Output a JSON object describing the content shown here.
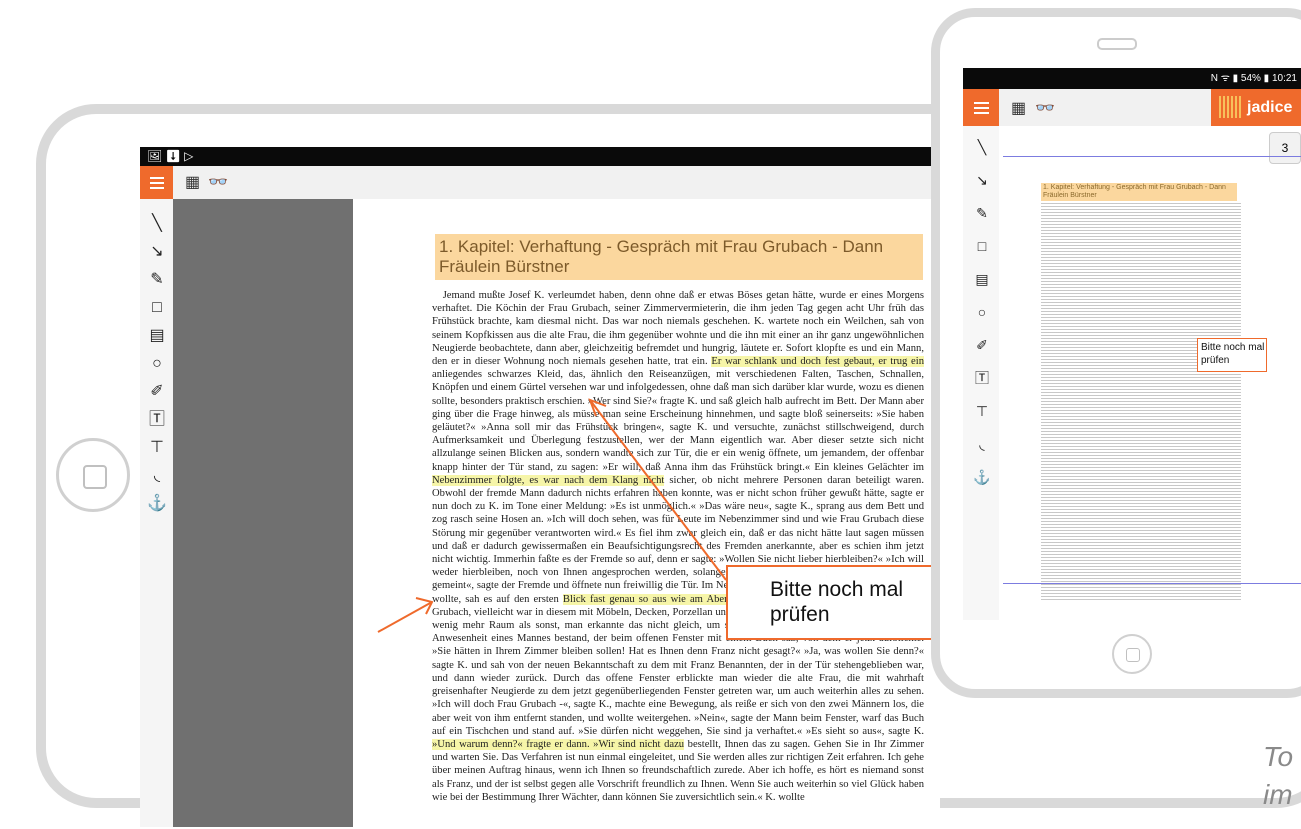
{
  "tablet": {
    "statusbar": {
      "icons": "🖼 ⬇ ▷"
    },
    "toolbar": {
      "grid_icon": "▦",
      "binoculars_icon": "👓"
    },
    "tools": [
      "line-tool-icon",
      "arrow-tool-icon",
      "freehand-tool-icon",
      "rectangle-tool-icon",
      "note-tool-icon",
      "ellipse-tool-icon",
      "highlighter-tool-icon",
      "text-tool-icon",
      "text-edit-tool-icon",
      "lasso-tool-icon",
      "stamp-tool-icon"
    ],
    "document": {
      "chapter_title": "1. Kapitel: Verhaftung - Gespräch mit Frau Grubach - Dann Fräulein Bürstner",
      "paragraph_1": "Jemand mußte Josef K. verleumdet haben, denn ohne daß er etwas Böses getan hätte, wurde er eines Morgens verhaftet. Die Köchin der Frau Grubach, seiner Zimmervermieterin, die ihm jeden Tag gegen acht Uhr früh das Frühstück brachte, kam diesmal nicht. Das war noch niemals geschehen. K. wartete noch ein Weilchen, sah von seinem Kopfkissen aus die alte Frau, die ihm gegenüber wohnte und die ihn mit einer an ihr ganz ungewöhnlichen Neugierde beobachtete, dann aber, gleichzeitig befremdet und hungrig, läutete er. Sofort klopfte es und ein Mann, den er in dieser Wohnung noch niemals gesehen hatte, trat ein.",
      "highlight_1": "Er war schlank und doch fest gebaut, er trug ein",
      "paragraph_2": "anliegendes schwarzes Kleid, das, ähnlich den Reiseanzügen, mit verschiedenen Falten, Taschen, Schnallen, Knöpfen und einem Gürtel versehen war und infolgedessen, ohne daß man sich darüber klar wurde, wozu es dienen sollte, besonders praktisch erschien. »Wer sind Sie?« fragte K. und saß gleich halb aufrecht im Bett. Der Mann aber ging über die Frage hinweg, als müsse man seine Erscheinung hinnehmen, und sagte bloß seinerseits: »Sie haben geläutet?« »Anna soll mir das Frühstück bringen«, sagte K. und versuchte, zunächst stillschweigend, durch Aufmerksamkeit und Überlegung festzustellen, wer der Mann eigentlich war. Aber dieser setzte sich nicht allzulange seinen Blicken aus, sondern wandte sich zur Tür, die er ein wenig öffnete, um jemandem, der offenbar knapp hinter der Tür stand, zu sagen: »Er will, daß Anna ihm das Frühstück bringt.« Ein kleines Gelächter im",
      "highlight_2": "Nebenzimmer folgte, es war nach dem Klang nicht",
      "paragraph_3": "sicher, ob nicht mehrere Personen daran beteiligt waren. Obwohl der fremde Mann dadurch nichts erfahren haben konnte, was er nicht schon früher gewußt hätte, sagte er nun doch zu K. im Tone einer Meldung: »Es ist unmöglich.« »Das wäre neu«, sagte K., sprang aus dem Bett und zog rasch seine Hosen an. »Ich will doch sehen, was für Leute im Nebenzimmer sind und wie Frau Grubach diese Störung mir gegenüber verantworten wird.« Es fiel ihm zwar gleich ein, daß er das nicht hätte laut sagen müssen und daß er dadurch gewissermaßen ein Beaufsichtigungsrecht des Fremden anerkannte, aber es schien ihm jetzt nicht wichtig. Immerhin faßte es der Fremde so auf, denn er sagte: »Wollen Sie nicht lieber hierbleiben?« »Ich will weder hierbleiben, noch von Ihnen angesprochen werden, solange Sie sich mir nicht vorstellen.« »Es war gut gemeint«, sagte der Fremde und öffnete nun freiwillig die Tür. Im Nebenzimmer, in das K. langsamer eintrat, als er wollte, sah es auf den ersten",
      "highlight_3": "Blick fast genau so aus wie am Abend vorher.",
      "paragraph_4": "Es war das Wohnzimmer der Frau Grubach, vielleicht war in diesem mit Möbeln, Decken, Porzellan und Photographien überfüllten Zimmer heute ein wenig mehr Raum als sonst, man erkannte das nicht gleich, um so weniger, als die Hauptveränderung in der Anwesenheit eines Mannes bestand, der beim offenen Fenster mit einem Buch saß, von dem er jetzt aufblickte. »Sie hätten in Ihrem Zimmer bleiben sollen! Hat es Ihnen denn Franz nicht gesagt?« »Ja, was wollen Sie denn?« sagte K. und sah von der neuen Bekanntschaft zu dem mit Franz Benannten, der in der Tür stehengeblieben war, und dann wieder zurück. Durch das offene Fenster erblickte man wieder die alte Frau, die mit wahrhaft greisenhafter Neugierde zu dem jetzt gegenüberliegenden Fenster getreten war, um auch weiterhin alles zu sehen. »Ich will doch Frau Grubach -«, sagte K., machte eine Bewegung, als reiße er sich von den zwei Männern los, die aber weit von ihm entfernt standen, und wollte weitergehen. »Nein«, sagte der Mann beim Fenster, warf das Buch auf ein Tischchen und stand auf. »Sie dürfen nicht weggehen, Sie sind ja verhaftet.« »Es sieht so aus«, sagte K.",
      "highlight_4": "»Und warum denn?« fragte er dann. »Wir sind nicht dazu",
      "paragraph_5": "bestellt, Ihnen das zu sagen. Gehen Sie in Ihr Zimmer und warten Sie. Das Verfahren ist nun einmal eingeleitet, und Sie werden alles zur richtigen Zeit erfahren. Ich gehe über meinen Auftrag hinaus, wenn ich Ihnen so freundschaftlich zurede. Aber ich hoffe, es hört es niemand sonst als Franz, und der ist selbst gegen alle Vorschrift freundlich zu Ihnen. Wenn Sie auch weiterhin so viel Glück haben wie bei der Bestimmung Ihrer Wächter, dann können Sie zuversichtlich sein.« K. wollte"
    },
    "annotation": {
      "note_text": "Bitte noch mal prüfen",
      "color": "#ef6a2c"
    }
  },
  "phone": {
    "statusbar": "N ᯤ ▮ 54% ▮ 10:21",
    "logo_text": "jadice",
    "page_badge": "3",
    "chapter_title": "1. Kapitel: Verhaftung - Gespräch mit Frau Grubach - Dann Fräulein Bürstner",
    "annotation": {
      "note_text": "Bitte noch mal prüfen"
    }
  },
  "tagline": "To im"
}
